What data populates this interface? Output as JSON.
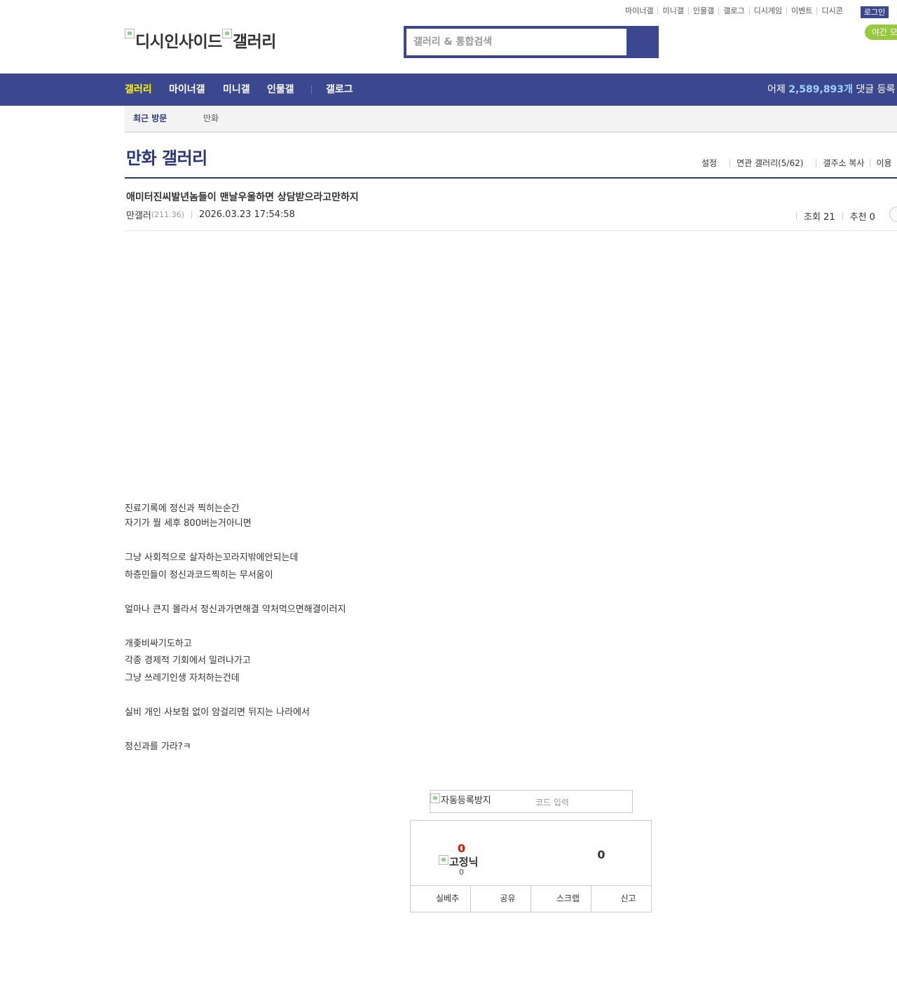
{
  "top_links": [
    "마이너갤",
    "미니갤",
    "인물갤",
    "갤로그",
    "디시게임",
    "이벤트",
    "디시콘"
  ],
  "login_label": "로그인",
  "night_mode_label": "야간 모드",
  "logo": {
    "site_alt": "디시인사이드",
    "gallery_alt": "갤러리"
  },
  "search": {
    "placeholder": "갤러리 & 통합검색",
    "icon": "search-icon"
  },
  "gnb": {
    "items": [
      "갤러리",
      "마이너갤",
      "미니갤",
      "인물갤",
      "갤로그"
    ],
    "stat_prefix": "어제 ",
    "stat_number": "2,589,893개",
    "stat_suffix": " 댓글 등록"
  },
  "recent": {
    "title": "최근 방문",
    "items": [
      "만화"
    ]
  },
  "gallery": {
    "title": "만화 갤러리",
    "menu": [
      "설정",
      "연관 갤러리(5/62)",
      "갤주소 복사",
      "이용"
    ]
  },
  "post": {
    "title": "애미터진씨발년놈들이 맨날우울하면 상담받으라고만하지",
    "author": "만갤러",
    "ip": "(211.36)",
    "date": "2026.03.23 17:54:58",
    "views_label": "조회 21",
    "recommend_label": "추천 0",
    "body": [
      "진료기록에 정신과 찍히는순간",
      "자기가 뭘 세후 800버는거아니면",
      "",
      "그냥 사회적으로 살자하는꼬라지밖에안되는데",
      "하층민들이 정신과코드찍히는 무서움이",
      "",
      "얼마나 큰지 몰라서 정신과가면해결 약처먹으면해결이러지",
      "",
      "개좆비싸기도하고",
      "각종 경제적 기회에서 밀려나가고",
      "그냥 쓰레기인생 자처하는건데",
      "",
      "실비 개인 사보험 없이 암걸리면 뒤지는 나라에서",
      "",
      "정신과를 가라?ㅋ"
    ]
  },
  "captcha": {
    "image_alt": "자동등록방지",
    "placeholder": "코드 입력"
  },
  "recommend": {
    "up_count": "0",
    "fix_nick_alt": "고정닉",
    "fix_count": "0",
    "down_count": "0",
    "buttons": [
      "실베추",
      "공유",
      "스크랩",
      "신고"
    ]
  }
}
